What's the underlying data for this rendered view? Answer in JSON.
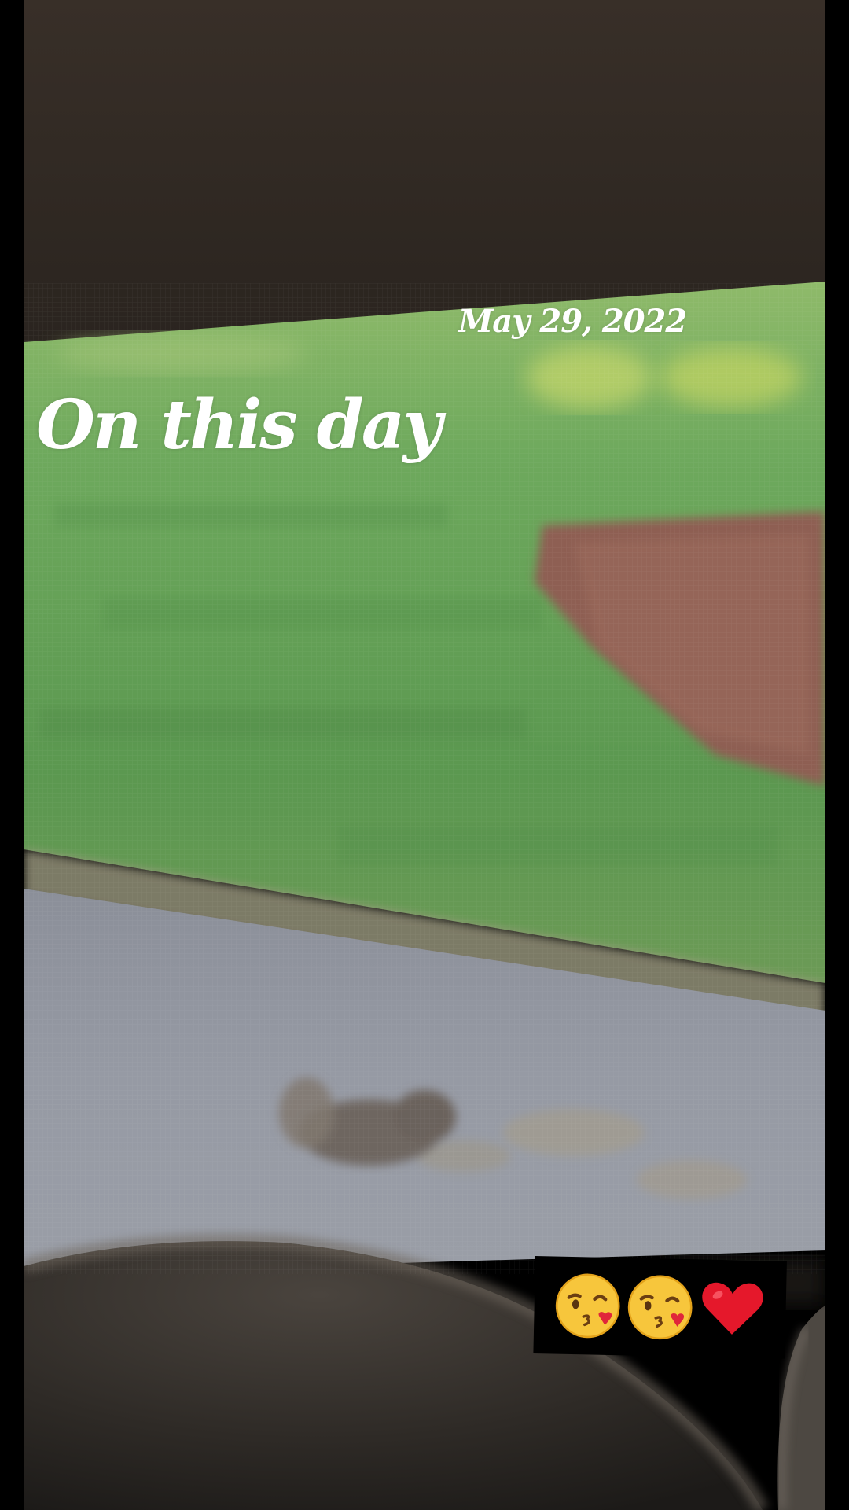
{
  "story": {
    "date": "May 29, 2022",
    "headline": "On this day"
  },
  "sticker": {
    "emojis": [
      "kissing-face-with-heart-emoji",
      "kissing-face-with-heart-emoji",
      "red-heart-emoji"
    ]
  },
  "colors": {
    "grass": "#5f9a52",
    "mulch": "#8e5f52",
    "asphalt": "#8c909b",
    "car_interior": "#3a3129"
  }
}
